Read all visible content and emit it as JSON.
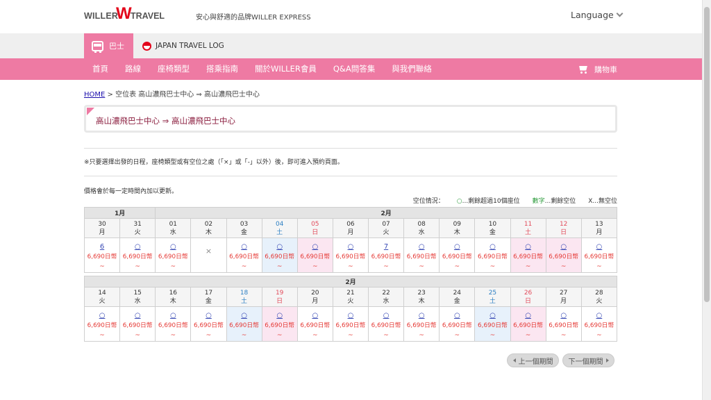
{
  "header": {
    "logo_left": "WILLER",
    "logo_w": "W",
    "logo_right": "TRAVEL",
    "tagline": "安心與舒適的品牌WILLER EXPRESS",
    "language": "Language"
  },
  "tabs": {
    "bus": "巴士",
    "log": "JAPAN TRAVEL LOG"
  },
  "nav": {
    "items": [
      "首頁",
      "路線",
      "座椅類型",
      "搭乘指南",
      "關於WILLER會員",
      "Q&A問答集",
      "與我們聯絡"
    ],
    "cart": "購物車"
  },
  "breadcrumb": {
    "home": "HOME",
    "rest": " > 空位表 高山濃飛巴士中心 ⇒ 高山濃飛巴士中心"
  },
  "page_title": "高山濃飛巴士中心 ⇒ 高山濃飛巴士中心",
  "notes": {
    "select": "※只要選擇出發的日程，座椅類型或有空位之處（「×」或「-」以外）後，即可進入預約頁面。",
    "price": "價格會於每一定時間內加以更新。"
  },
  "legend": {
    "label": "空位情況：",
    "circle": "○",
    "circle_text": "...剩餘超過10個座位",
    "digits": "數字",
    "digits_text": "...剩餘空位",
    "cross_text": "X...無空位"
  },
  "calendar": {
    "week1": {
      "months": [
        {
          "label": "1月",
          "span": 2
        },
        {
          "label": "2月",
          "span": 13
        }
      ],
      "days": [
        {
          "d": "30",
          "w": "月",
          "t": "",
          "s": "6",
          "p": "6,690日幣",
          "x": "~"
        },
        {
          "d": "31",
          "w": "火",
          "t": "",
          "s": "○",
          "p": "6,690日幣",
          "x": "~"
        },
        {
          "d": "01",
          "w": "水",
          "t": "",
          "s": "○",
          "p": "6,690日幣",
          "x": "~"
        },
        {
          "d": "02",
          "w": "木",
          "t": "",
          "s": "×",
          "p": "",
          "x": ""
        },
        {
          "d": "03",
          "w": "金",
          "t": "",
          "s": "○",
          "p": "6,690日幣",
          "x": "~"
        },
        {
          "d": "04",
          "w": "土",
          "t": "sat",
          "s": "○",
          "p": "6,690日幣",
          "x": "~"
        },
        {
          "d": "05",
          "w": "日",
          "t": "sun",
          "s": "○",
          "p": "6,690日幣",
          "x": "~"
        },
        {
          "d": "06",
          "w": "月",
          "t": "",
          "s": "○",
          "p": "6,690日幣",
          "x": "~"
        },
        {
          "d": "07",
          "w": "火",
          "t": "",
          "s": "7",
          "p": "6,690日幣",
          "x": "~"
        },
        {
          "d": "08",
          "w": "水",
          "t": "",
          "s": "○",
          "p": "6,690日幣",
          "x": "~"
        },
        {
          "d": "09",
          "w": "木",
          "t": "",
          "s": "○",
          "p": "6,690日幣",
          "x": "~"
        },
        {
          "d": "10",
          "w": "金",
          "t": "",
          "s": "○",
          "p": "6,690日幣",
          "x": "~"
        },
        {
          "d": "11",
          "w": "土",
          "t": "sun",
          "s": "○",
          "p": "6,690日幣",
          "x": "~"
        },
        {
          "d": "12",
          "w": "日",
          "t": "sun",
          "s": "○",
          "p": "6,690日幣",
          "x": "~"
        },
        {
          "d": "13",
          "w": "月",
          "t": "",
          "s": "○",
          "p": "6,690日幣",
          "x": "~"
        }
      ]
    },
    "week2": {
      "months": [
        {
          "label": "2月",
          "span": 15
        }
      ],
      "days": [
        {
          "d": "14",
          "w": "火",
          "t": "",
          "s": "○",
          "p": "6,690日幣",
          "x": "~"
        },
        {
          "d": "15",
          "w": "水",
          "t": "",
          "s": "○",
          "p": "6,690日幣",
          "x": "~"
        },
        {
          "d": "16",
          "w": "木",
          "t": "",
          "s": "○",
          "p": "6,690日幣",
          "x": "~"
        },
        {
          "d": "17",
          "w": "金",
          "t": "",
          "s": "○",
          "p": "6,690日幣",
          "x": "~"
        },
        {
          "d": "18",
          "w": "土",
          "t": "sat",
          "s": "○",
          "p": "6,690日幣",
          "x": "~"
        },
        {
          "d": "19",
          "w": "日",
          "t": "sun",
          "s": "○",
          "p": "6,690日幣",
          "x": "~"
        },
        {
          "d": "20",
          "w": "月",
          "t": "",
          "s": "○",
          "p": "6,690日幣",
          "x": "~"
        },
        {
          "d": "21",
          "w": "火",
          "t": "",
          "s": "○",
          "p": "6,690日幣",
          "x": "~"
        },
        {
          "d": "22",
          "w": "水",
          "t": "",
          "s": "○",
          "p": "6,690日幣",
          "x": "~"
        },
        {
          "d": "23",
          "w": "木",
          "t": "",
          "s": "○",
          "p": "6,690日幣",
          "x": "~"
        },
        {
          "d": "24",
          "w": "金",
          "t": "",
          "s": "○",
          "p": "6,690日幣",
          "x": "~"
        },
        {
          "d": "25",
          "w": "土",
          "t": "sat",
          "s": "○",
          "p": "6,690日幣",
          "x": "~"
        },
        {
          "d": "26",
          "w": "日",
          "t": "sun",
          "s": "○",
          "p": "6,690日幣",
          "x": "~"
        },
        {
          "d": "27",
          "w": "月",
          "t": "",
          "s": "○",
          "p": "6,690日幣",
          "x": "~"
        },
        {
          "d": "28",
          "w": "火",
          "t": "",
          "s": "○",
          "p": "6,690日幣",
          "x": "~"
        }
      ]
    }
  },
  "paging": {
    "prev": "上一個期間",
    "next": "下一個期間"
  },
  "colors": {
    "brand_pink": "#ee7aa3",
    "logo_red": "#e3061b",
    "price_red": "#e53935",
    "saturday_blue": "#2c7fc3",
    "sunday_red": "#e24b5b"
  }
}
